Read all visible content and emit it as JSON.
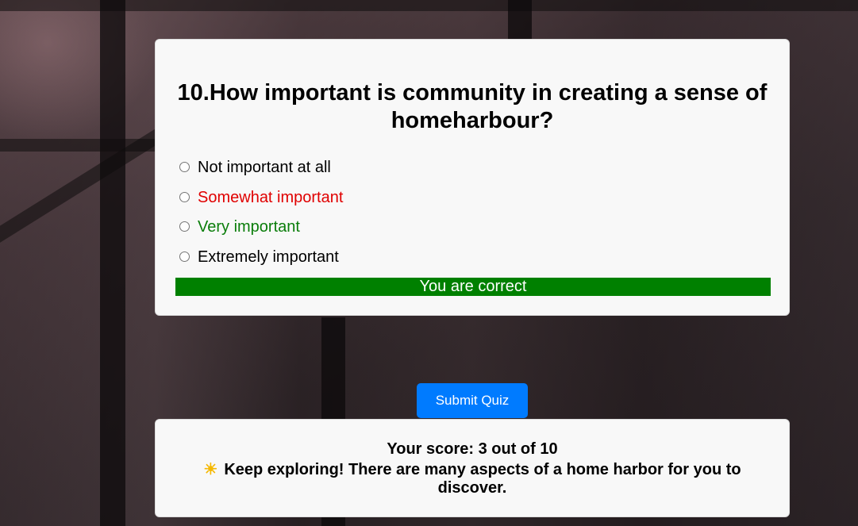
{
  "quiz": {
    "question": "10.How important is community in creating a sense of homeharbour?",
    "options": [
      {
        "label": "Not important at all",
        "state": "neutral"
      },
      {
        "label": "Somewhat important",
        "state": "wrong"
      },
      {
        "label": "Very important",
        "state": "correct"
      },
      {
        "label": "Extremely important",
        "state": "neutral"
      }
    ],
    "feedback": "You are correct",
    "feedback_color": "#008000",
    "wrong_color": "#e00000",
    "correct_color": "#0a7d0a"
  },
  "submit": {
    "label": "Submit Quiz",
    "color": "#007bff"
  },
  "result": {
    "score": "Your score: 3 out of 10",
    "icon": "sun-icon",
    "message": "Keep exploring! There are many aspects of a home harbor for you to discover."
  }
}
